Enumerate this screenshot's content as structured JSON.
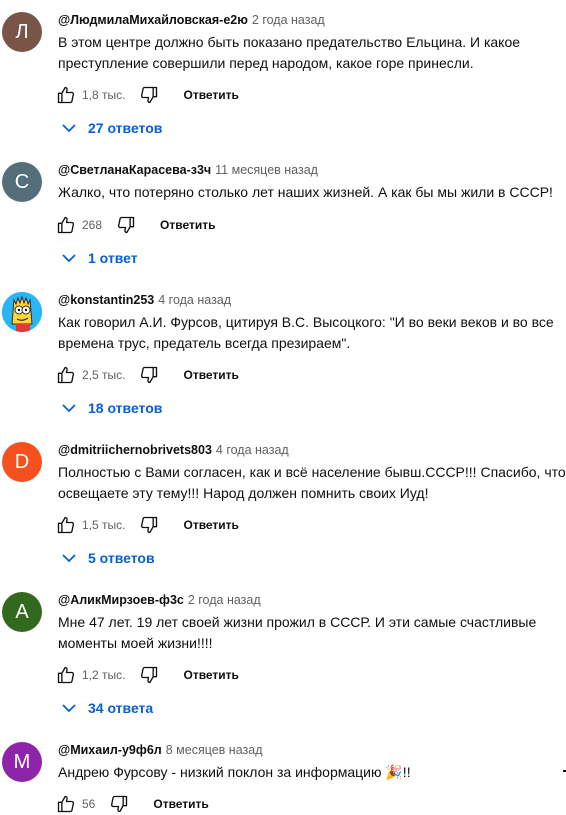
{
  "comments": [
    {
      "author": "@ЛюдмилаМихайловская-е2ю",
      "time": "2 года назад",
      "text": "В этом центре должно быть показано предательство Ельцина. И какое\nпреступление совершили перед народом, какое горе принесли.",
      "likes": "1,8 тыс.",
      "reply": "Ответить",
      "replies": "27 ответов",
      "avatar_letter": "Л",
      "avatar_color": "#795548"
    },
    {
      "author": "@СветланаКарасева-з3ч",
      "time": "11 месяцев назад",
      "text": "Жалко, что потеряно столько лет  наших жизней. А как бы мы жили в СССР!",
      "likes": "268",
      "reply": "Ответить",
      "replies": "1 ответ",
      "avatar_letter": "С",
      "avatar_color": "#546e7a"
    },
    {
      "author": "@konstantin253",
      "time": "4 года назад",
      "text": "Как говорил А.И. Фурсов, цитируя В.С. Высоцкого: \"И во веки веков и во все\nвремена трус, предатель всегда презираем\".",
      "likes": "2,5 тыс.",
      "reply": "Ответить",
      "replies": "18 ответов",
      "avatar_letter": "",
      "avatar_color": "#29b6f6"
    },
    {
      "author": "@dmitriichernobrivets803",
      "time": "4 года назад",
      "text": "Полностью с Вами согласен, как и  всё население бывш.СССР!!! Спасибо, что\nосвещаете эту тему!!!  Народ должен помнить своих Иуд!",
      "likes": "1,5 тыс.",
      "reply": "Ответить",
      "replies": "5 ответов",
      "avatar_letter": "D",
      "avatar_color": "#f4511e"
    },
    {
      "author": "@АликМирзоев-ф3с",
      "time": "2 года назад",
      "text": "Мне 47 лет. 19 лет своей жизни прожил в СССР. И эти самые счастливые\nмоменты моей жизни!!!!",
      "likes": "1,2 тыс.",
      "reply": "Ответить",
      "replies": "34 ответа",
      "avatar_letter": "А",
      "avatar_color": "#33691e"
    },
    {
      "author": "@Михаил-у9ф6л",
      "time": "8 месяцев назад",
      "text": "Андрею Фурсову - низкий поклон за информацию 🎉!!",
      "likes": "56",
      "reply": "Ответить",
      "avatar_letter": "М",
      "avatar_color": "#8e24aa"
    }
  ],
  "icons": {
    "like": "thumbs-up-icon",
    "dislike": "thumbs-down-icon",
    "expand": "chevron-down-icon",
    "avatar_image": "yellow-cartoon-character-avatar"
  }
}
